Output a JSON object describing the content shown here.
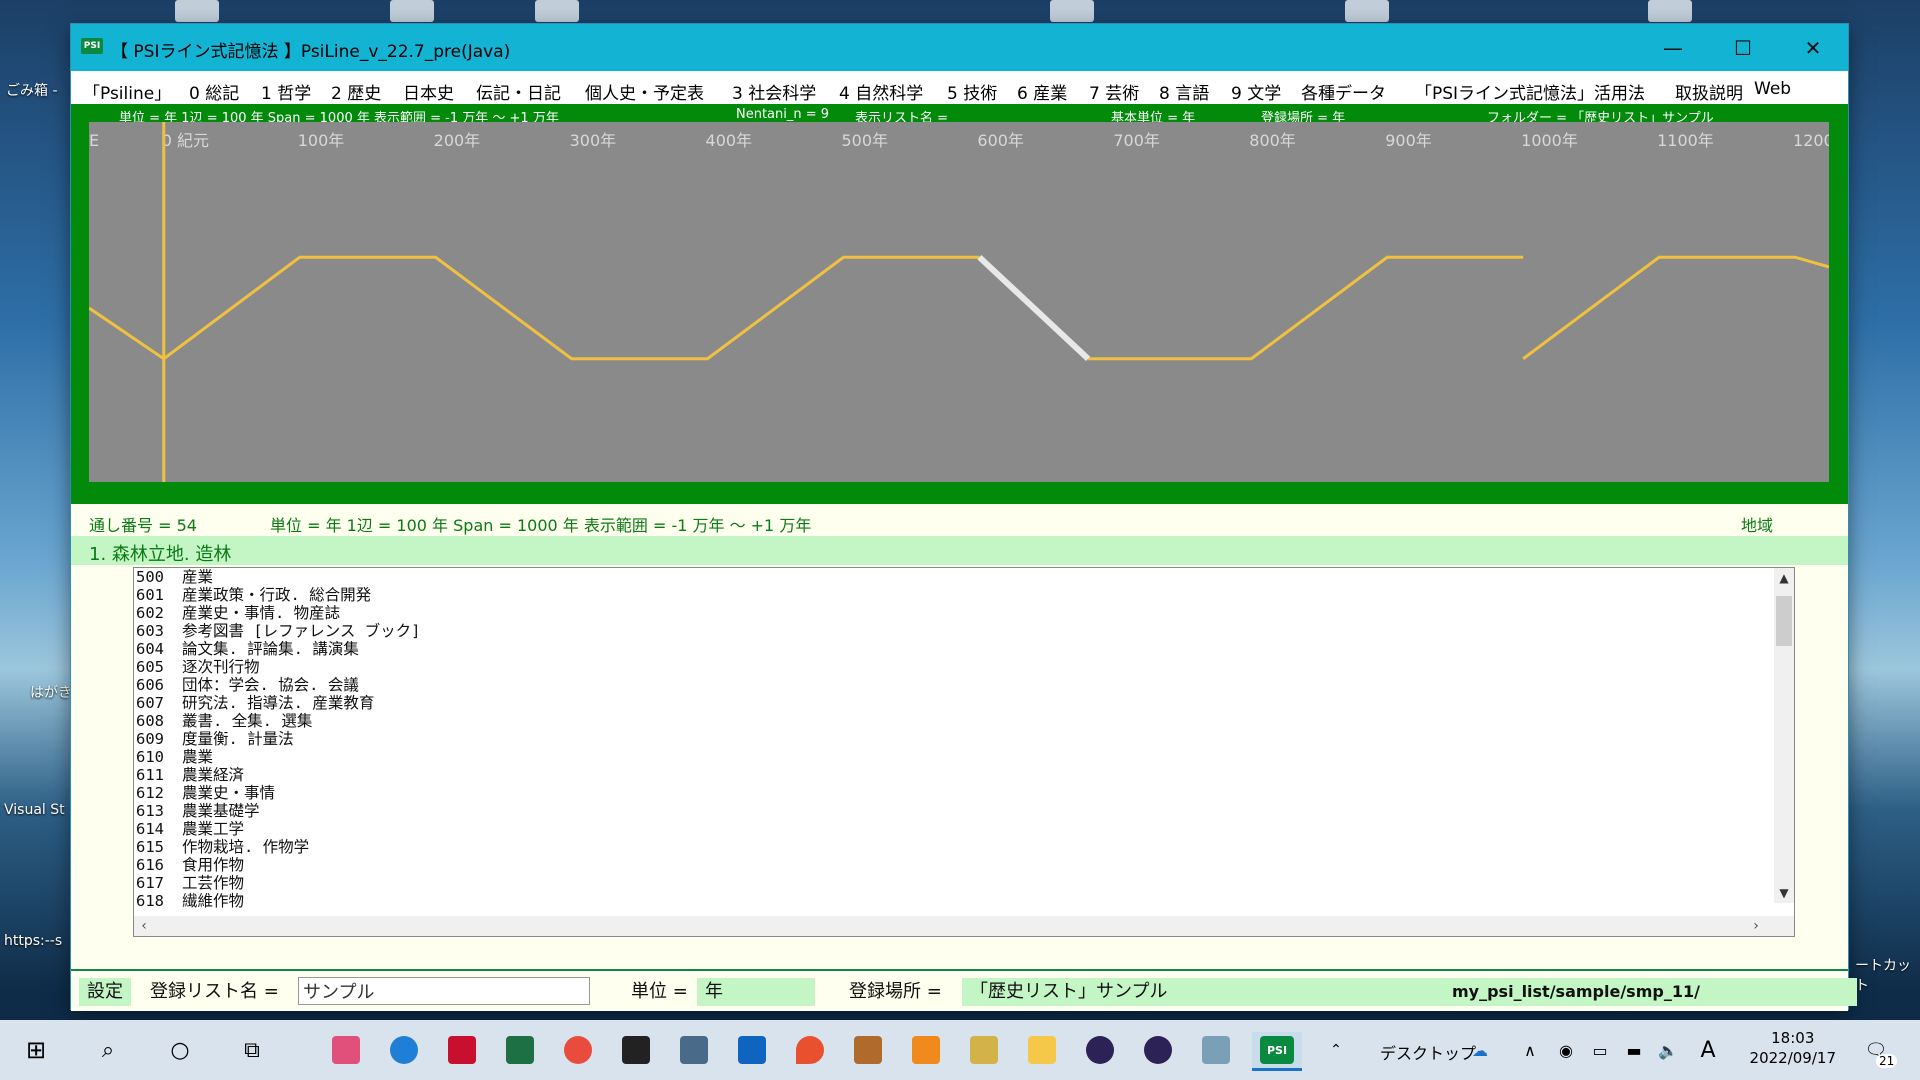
{
  "desktop": {
    "icons": [
      "ごみ箱 -",
      "はがき",
      "Visual St",
      "https:--s",
      "ートカット"
    ]
  },
  "window": {
    "icon_text": "PSI",
    "title": "【 PSIライン式記憶法 】PsiLine_v_22.7_pre(Java)",
    "minimize": "—",
    "maximize": "☐",
    "close": "✕"
  },
  "menu": {
    "items": [
      "「Psiline」",
      "0 総記",
      "1 哲学",
      "2 歴史",
      "日本史",
      "伝記・日記",
      "個人史・予定表",
      "3 社会科学",
      "4 自然科学",
      "5 技術",
      "6 産業",
      "7 芸術",
      "8 言語",
      "9 文学",
      "各種データ",
      "「PSIライン式記憶法」活用法",
      "取扱説明",
      "Web"
    ]
  },
  "chart_info": {
    "unit": "単位 = 年  1辺 = 100 年  Span = 1000 年  表示範囲 = -1 万年 ～ +1 万年",
    "nentani": "Nentani_n = 9",
    "list_name": "表示リスト名 =",
    "base_unit": "基本単位 = 年",
    "location": "登録場所 = 年",
    "folder": "フォルダー = 「歴史リスト」サンプル"
  },
  "chart_data": {
    "type": "line",
    "tick_labels": [
      "E",
      "0 紀元",
      "100年",
      "200年",
      "300年",
      "400年",
      "500年",
      "600年",
      "700年",
      "800年",
      "900年",
      "1000年",
      "1100年",
      "1200"
    ],
    "tick_values": [
      -55,
      0,
      100,
      200,
      300,
      400,
      500,
      600,
      700,
      800,
      900,
      1000,
      1100,
      1200
    ],
    "xlim": [
      -55,
      1225
    ],
    "ylim": [
      0,
      1
    ],
    "cursor_x": 0,
    "series": [
      {
        "segments": [
          [
            [
              -55,
              0.5
            ],
            [
              0,
              0.03
            ],
            [
              100,
              0.97
            ],
            [
              200,
              0.97
            ],
            [
              300,
              0.03
            ],
            [
              400,
              0.03
            ],
            [
              500,
              0.97
            ],
            [
              600,
              0.97
            ]
          ],
          [
            [
              680,
              0.03
            ],
            [
              800,
              0.03
            ],
            [
              900,
              0.97
            ],
            [
              1000,
              0.97
            ]
          ],
          [
            [
              1000,
              0.03
            ],
            [
              1100,
              0.97
            ],
            [
              1200,
              0.97
            ],
            [
              1225,
              0.88
            ]
          ]
        ],
        "color": "#f0c040"
      },
      {
        "segments": [
          [
            [
              600,
              0.97
            ],
            [
              680,
              0.03
            ]
          ]
        ],
        "color": "#e8e8e8"
      }
    ]
  },
  "infoline": {
    "serial": "通し番号 = 54",
    "unit": "単位 = 年  1辺 = 100 年  Span = 1000 年  表示範囲 = -1 万年 ～ +1 万年",
    "region": "地域"
  },
  "selected_item": "1. 森林立地. 造林",
  "list": [
    {
      "code": "500",
      "text": "産業"
    },
    {
      "code": "601",
      "text": "産業政策・行政. 総合開発"
    },
    {
      "code": "602",
      "text": "産業史・事情. 物産誌"
    },
    {
      "code": "603",
      "text": "参考図書 [レファレンス ブック]"
    },
    {
      "code": "604",
      "text": "論文集. 評論集. 講演集"
    },
    {
      "code": "605",
      "text": "逐次刊行物"
    },
    {
      "code": "606",
      "text": "団体：学会. 協会. 会議"
    },
    {
      "code": "607",
      "text": "研究法. 指導法. 産業教育"
    },
    {
      "code": "608",
      "text": "叢書. 全集. 選集"
    },
    {
      "code": "609",
      "text": "度量衡. 計量法"
    },
    {
      "code": "610",
      "text": "農業"
    },
    {
      "code": "611",
      "text": "農業経済"
    },
    {
      "code": "612",
      "text": "農業史・事情"
    },
    {
      "code": "613",
      "text": "農業基礎学"
    },
    {
      "code": "614",
      "text": "農業工学"
    },
    {
      "code": "615",
      "text": "作物栽培. 作物学"
    },
    {
      "code": "616",
      "text": "食用作物"
    },
    {
      "code": "617",
      "text": "工芸作物"
    },
    {
      "code": "618",
      "text": "繊維作物"
    }
  ],
  "bottom": {
    "settings": "設定",
    "reg_list_label": "登録リスト名 =",
    "reg_list_value": "サンプル",
    "unit_label": "単位 =",
    "unit_value": "年",
    "location_label": "登録場所 =",
    "location_value": "「歴史リスト」サンプル",
    "path": "my_psi_list/sample/smp_11/"
  },
  "taskbar": {
    "desktop_label": "デスクトップ",
    "ime": "A",
    "time": "18:03",
    "date": "2022/09/17",
    "notifications": "21",
    "psi_label": "PSI"
  }
}
